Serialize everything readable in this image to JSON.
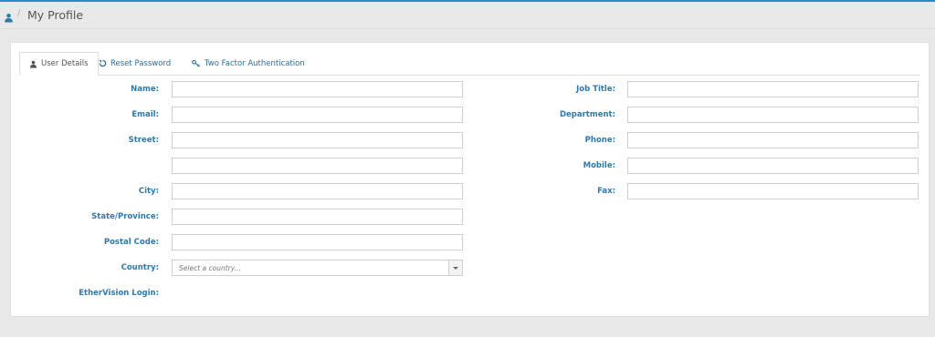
{
  "header": {
    "title": "My Profile",
    "separator": "/",
    "accent_color": "#2d8cc0",
    "home_icon": "user-icon"
  },
  "tabs": [
    {
      "label": "User Details",
      "icon": "user-icon",
      "active": true
    },
    {
      "label": "Reset Password",
      "icon": "refresh-icon",
      "active": false
    },
    {
      "label": "Two Factor Authentication",
      "icon": "key-icon",
      "active": false
    }
  ],
  "form": {
    "left": {
      "name_label": "Name:",
      "email_label": "Email:",
      "street_label": "Street:",
      "city_label": "City:",
      "state_label": "State/Province:",
      "postal_label": "Postal Code:",
      "country_label": "Country:",
      "country_placeholder": "Select a country...",
      "login_label": "EtherVision Login:"
    },
    "right": {
      "job_title_label": "Job Title:",
      "department_label": "Department:",
      "phone_label": "Phone:",
      "mobile_label": "Mobile:",
      "fax_label": "Fax:"
    },
    "label_color": "#2a7bb0"
  }
}
